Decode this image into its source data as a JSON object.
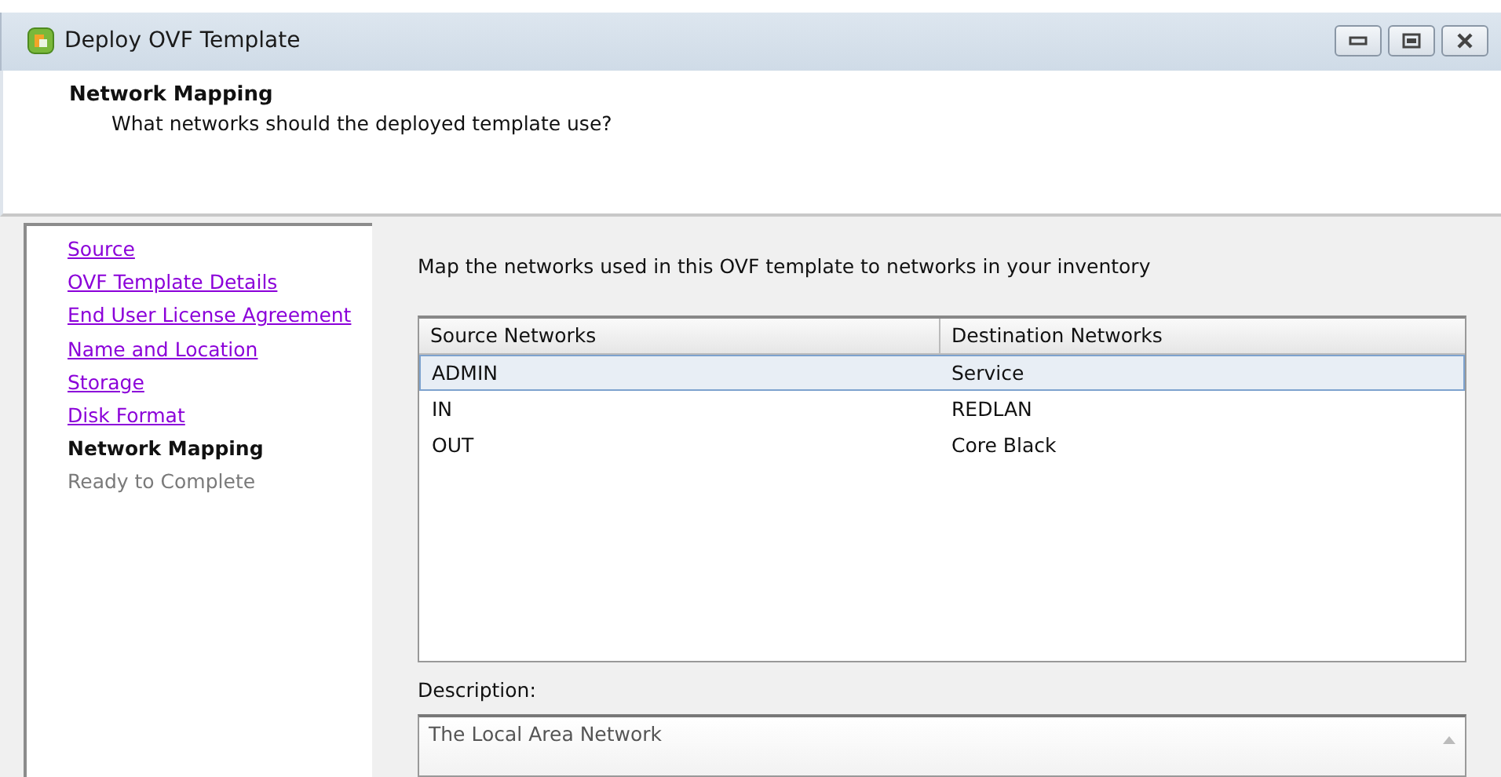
{
  "window": {
    "title": "Deploy OVF Template"
  },
  "header": {
    "title": "Network Mapping",
    "subtitle": "What networks should the deployed template use?"
  },
  "steps": [
    {
      "label": "Source",
      "kind": "done"
    },
    {
      "label": "OVF Template Details",
      "kind": "done"
    },
    {
      "label": "End User License Agreement",
      "kind": "done"
    },
    {
      "label": "Name and Location",
      "kind": "done"
    },
    {
      "label": "Storage",
      "kind": "done"
    },
    {
      "label": "Disk Format",
      "kind": "done"
    },
    {
      "label": "Network Mapping",
      "kind": "current"
    },
    {
      "label": "Ready to Complete",
      "kind": "pending"
    }
  ],
  "instruction": "Map the networks used in this OVF template to networks in your inventory",
  "table": {
    "columns": [
      "Source Networks",
      "Destination Networks"
    ],
    "rows": [
      {
        "cells": [
          "ADMIN",
          "Service"
        ],
        "selected": true
      },
      {
        "cells": [
          "IN",
          "REDLAN"
        ],
        "selected": false
      },
      {
        "cells": [
          "OUT",
          "Core Black"
        ],
        "selected": false
      }
    ]
  },
  "description": {
    "label": "Description:",
    "value": "The Local Area Network"
  }
}
